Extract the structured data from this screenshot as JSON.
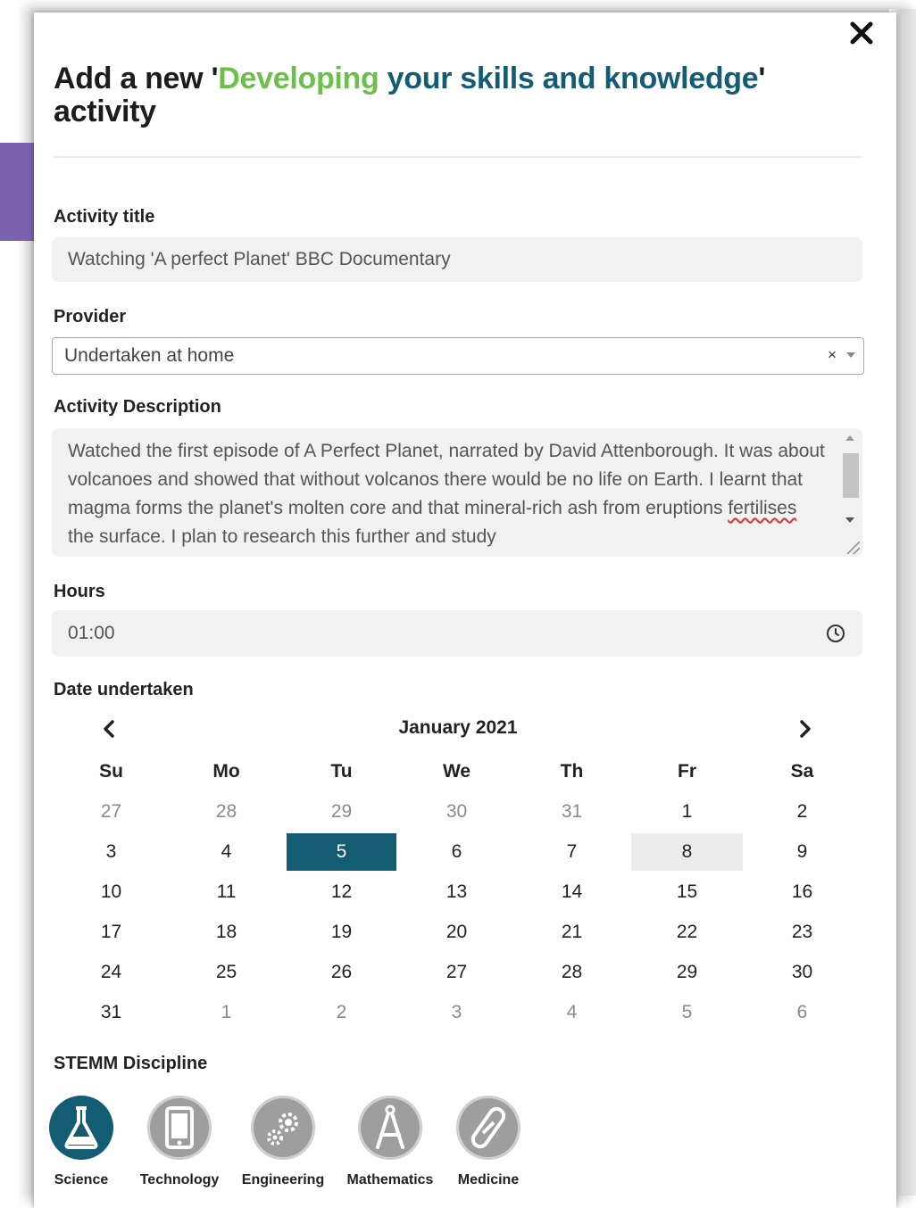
{
  "modal": {
    "title_prefix": "Add a new '",
    "title_highlight_green": "Developing",
    "title_highlight_teal": " your skills and knowledge",
    "title_suffix": "' activity",
    "close_icon": "close-icon"
  },
  "form": {
    "activity_title": {
      "label": "Activity title",
      "value": "Watching 'A perfect Planet' BBC Documentary"
    },
    "provider": {
      "label": "Provider",
      "value": "Undertaken at home",
      "clear": "×"
    },
    "description": {
      "label": "Activity Description",
      "value_before": "Watched the first episode of A Perfect Planet, narrated by David  Attenborough. It was about volcanoes and showed that without volcanos there would be no life on Earth. I learnt that magma forms the planet's molten core and that mineral-rich ash from eruptions ",
      "misspelled": "fertilises",
      "value_after": " the surface. I plan to research this further and study"
    },
    "hours": {
      "label": "Hours",
      "value": "01:00",
      "icon": "clock-icon"
    },
    "date": {
      "label": "Date undertaken",
      "month": "January 2021",
      "weekdays": [
        "Su",
        "Mo",
        "Tu",
        "We",
        "Th",
        "Fr",
        "Sa"
      ],
      "weeks": [
        [
          "27",
          "28",
          "29",
          "30",
          "31",
          "1",
          "2"
        ],
        [
          "3",
          "4",
          "5",
          "6",
          "7",
          "8",
          "9"
        ],
        [
          "10",
          "11",
          "12",
          "13",
          "14",
          "15",
          "16"
        ],
        [
          "17",
          "18",
          "19",
          "20",
          "21",
          "22",
          "23"
        ],
        [
          "24",
          "25",
          "26",
          "27",
          "28",
          "29",
          "30"
        ],
        [
          "31",
          "1",
          "2",
          "3",
          "4",
          "5",
          "6"
        ]
      ],
      "selected_day": "5",
      "highlighted_day": "8"
    },
    "stemm": {
      "label": "STEMM Discipline",
      "options": [
        {
          "name": "Science",
          "icon": "flask-icon",
          "active": true
        },
        {
          "name": "Technology",
          "icon": "tablet-icon",
          "active": false
        },
        {
          "name": "Engineering",
          "icon": "gears-icon",
          "active": false
        },
        {
          "name": "Mathematics",
          "icon": "compass-icon",
          "active": false
        },
        {
          "name": "Medicine",
          "icon": "pill-icon",
          "active": false
        }
      ]
    }
  },
  "colors": {
    "accent_teal": "#135c73",
    "accent_green": "#6cc04a",
    "inactive_icon": "#9e9e9e",
    "purple_tab": "#7a62ae"
  }
}
